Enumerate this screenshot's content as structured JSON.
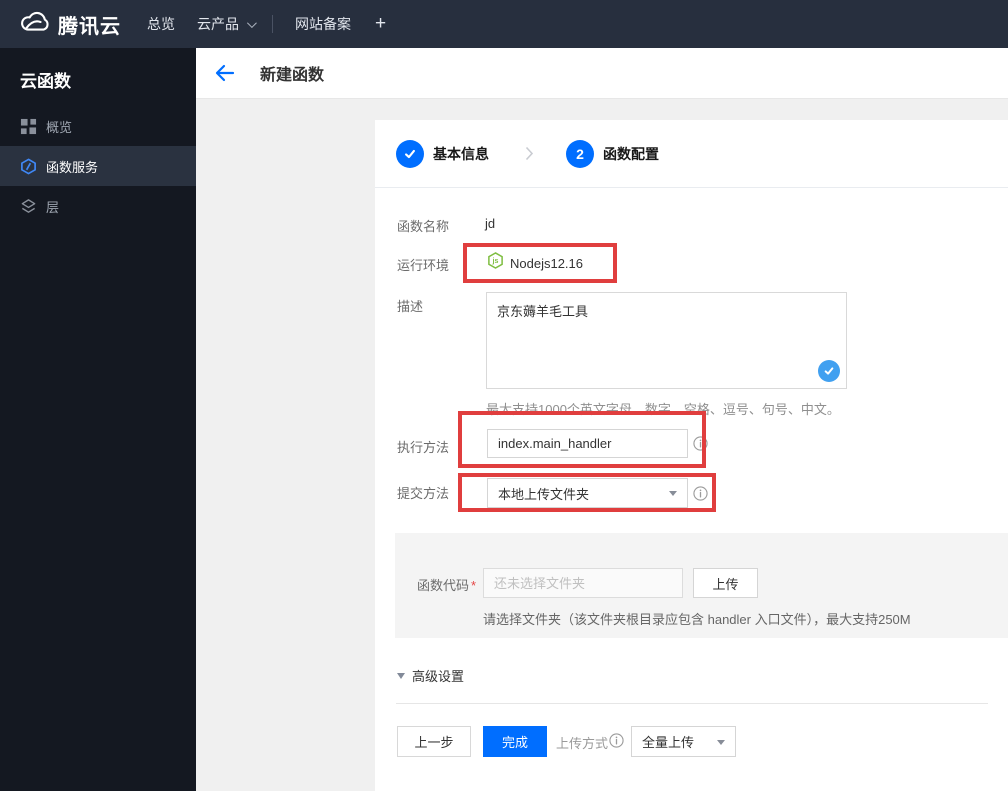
{
  "topnav": {
    "brand": "腾讯云",
    "overview": "总览",
    "products": "云产品",
    "icp": "网站备案",
    "add": "+"
  },
  "sidebar": {
    "title": "云函数",
    "items": [
      {
        "label": "概览",
        "icon": "grid-icon",
        "active": false
      },
      {
        "label": "函数服务",
        "icon": "scf-hexagon-icon",
        "active": true
      },
      {
        "label": "层",
        "icon": "layers-icon",
        "active": false
      }
    ]
  },
  "header": {
    "title": "新建函数"
  },
  "steps": {
    "step1_label": "基本信息",
    "step2_num": "2",
    "step2_label": "函数配置"
  },
  "form": {
    "name_label": "函数名称",
    "name_value": "jd",
    "runtime_label": "运行环境",
    "runtime_value": "Nodejs12.16",
    "desc_label": "描述",
    "desc_value": "京东薅羊毛工具",
    "desc_help": "最大支持1000个英文字母、数字、空格、逗号、句号、中文。",
    "handler_label": "执行方法",
    "handler_value": "index.main_handler",
    "submit_label": "提交方法",
    "submit_value": "本地上传文件夹",
    "code_label": "函数代码",
    "required_mark": "*",
    "code_placeholder": "还未选择文件夹",
    "upload_button": "上传",
    "code_help": "请选择文件夹（该文件夹根目录应包含 handler 入口文件），最大支持250M",
    "advanced_label": "高级设置"
  },
  "footer": {
    "prev_button": "上一步",
    "finish_button": "完成",
    "upload_mode_label": "上传方式",
    "upload_mode_value": "全量上传"
  },
  "colors": {
    "accent_blue": "#006eff",
    "annotation_red": "#e03e3e",
    "nodejs_green": "#7fbe42",
    "check_bubble_blue": "#41a0f0",
    "topnav_bg": "#272f3e",
    "sidebar_bg": "#141821"
  }
}
